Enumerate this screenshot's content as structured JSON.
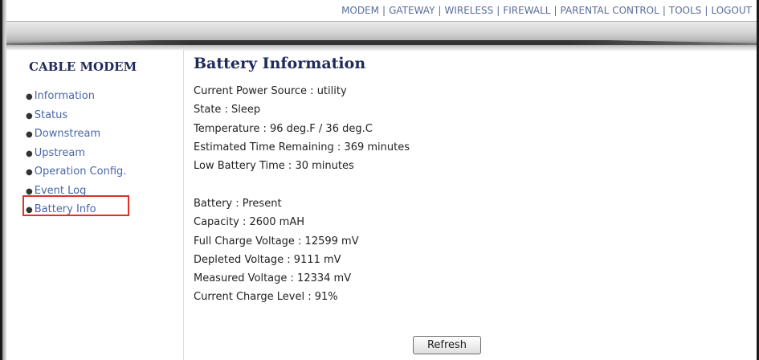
{
  "topnav": {
    "items": [
      "MODEM",
      "GATEWAY",
      "WIRELESS",
      "FIREWALL",
      "PARENTAL CONTROL",
      "TOOLS",
      "LOGOUT"
    ],
    "separator": "|"
  },
  "sidebar": {
    "title": "CABLE MODEM",
    "items": [
      {
        "label": "Information"
      },
      {
        "label": "Status"
      },
      {
        "label": "Downstream"
      },
      {
        "label": "Upstream"
      },
      {
        "label": "Operation Config."
      },
      {
        "label": "Event Log"
      },
      {
        "label": "Battery Info"
      }
    ],
    "highlighted": "Battery Info",
    "highlight_color": "#e0302a"
  },
  "main": {
    "title": "Battery Information",
    "power": [
      "Current Power Source : utility",
      "State : Sleep",
      "Temperature : 96 deg.F / 36 deg.C",
      "Estimated Time Remaining : 369 minutes",
      "Low Battery Time : 30 minutes"
    ],
    "battery": [
      "Battery : Present",
      "Capacity : 2600 mAH",
      "Full Charge Voltage : 12599 mV",
      "Depleted Voltage : 9111 mV",
      "Measured Voltage : 12334 mV",
      "Current Charge Level : 91%"
    ],
    "refresh_label": "Refresh"
  },
  "colors": {
    "heading": "#1f2a5a",
    "link": "#4a66a8",
    "nav": "#5a6c9a"
  }
}
